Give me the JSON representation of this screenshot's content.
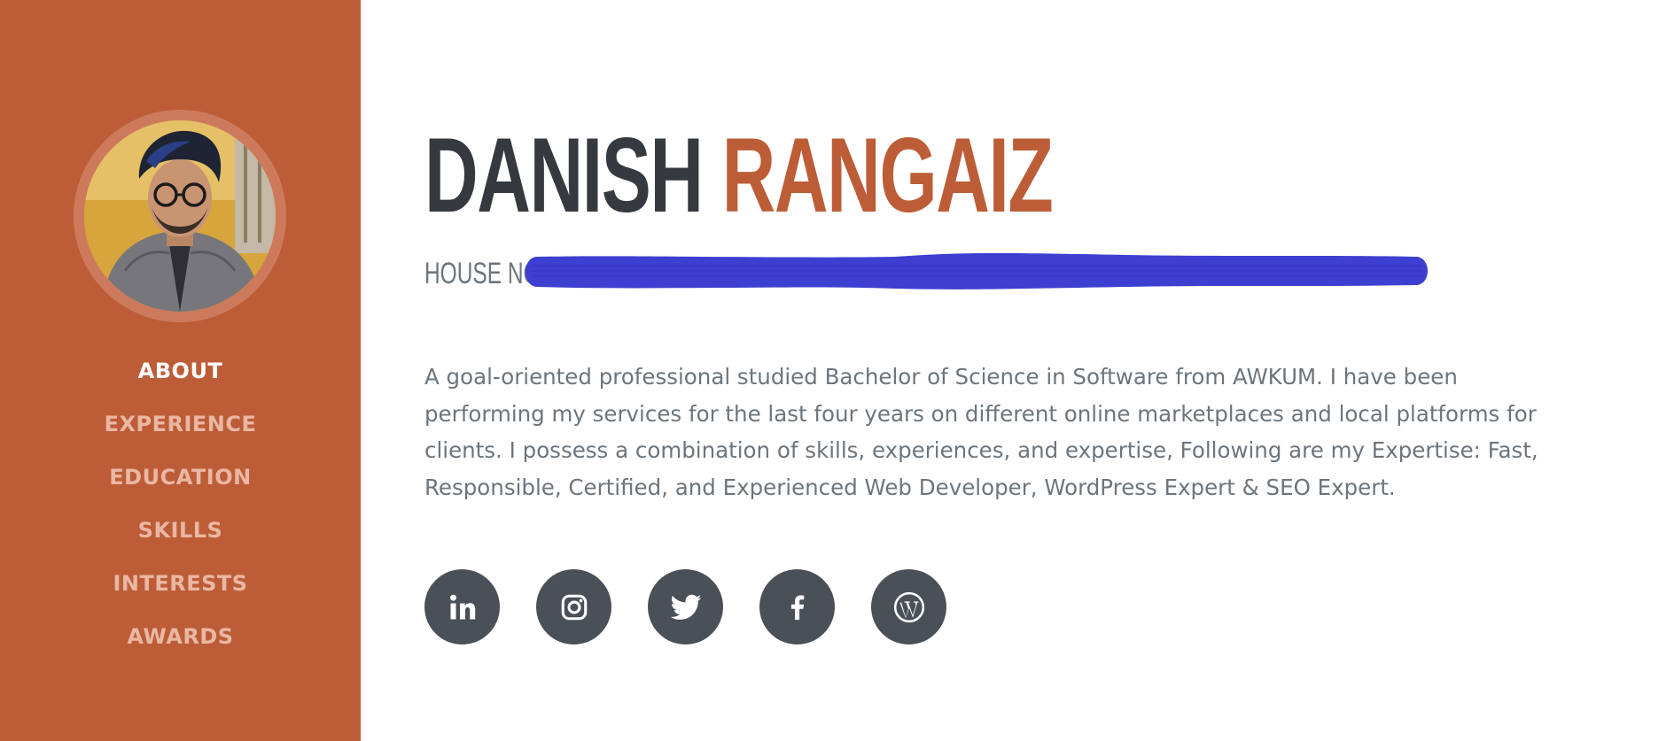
{
  "profile": {
    "first_name": "DANISH",
    "last_name": "RANGAIZ",
    "address_label": "HOUSE NO",
    "about": "A goal-oriented professional studied Bachelor of Science in Software from AWKUM. I have been performing my services for the last four years on different online marketplaces and local platforms for clients. I possess a combination of skills, experiences, and expertise, Following are my Expertise: Fast, Responsible, Certified, and Experienced Web Developer, WordPress Expert & SEO Expert."
  },
  "sidebar": {
    "avatar": "profile-photo",
    "nav": [
      {
        "label": "ABOUT",
        "active": true
      },
      {
        "label": "EXPERIENCE",
        "active": false
      },
      {
        "label": "EDUCATION",
        "active": false
      },
      {
        "label": "SKILLS",
        "active": false
      },
      {
        "label": "INTERESTS",
        "active": false
      },
      {
        "label": "AWARDS",
        "active": false
      }
    ]
  },
  "social": [
    {
      "icon": "linkedin-icon"
    },
    {
      "icon": "instagram-icon"
    },
    {
      "icon": "twitter-icon"
    },
    {
      "icon": "facebook-icon"
    },
    {
      "icon": "wordpress-icon"
    }
  ],
  "colors": {
    "primary": "#bd5d38",
    "sidebar_bg": "#bd5d38",
    "nav_active": "#ffffff",
    "nav_inactive": "#eab7a3",
    "heading_dark": "#343a40",
    "body_text": "#6c757d",
    "social_bg": "#495057",
    "redaction": "#3d3fd0"
  }
}
